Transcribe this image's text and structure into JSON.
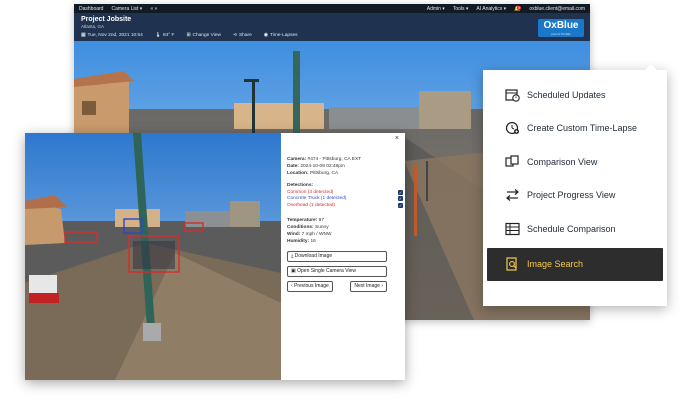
{
  "topnav": {
    "dashboard": "Dashboard",
    "camera_list": "Camera List ▾",
    "nav_arrows": "« »",
    "admin": "Admin ▾",
    "tools": "Tools ▾",
    "ai_analytics": "AI Analytics ▾",
    "notif_count": "9",
    "user_email": "oxblue.client@email.com"
  },
  "header": {
    "title": "Project Jobsite",
    "location": "Atlanta, GA",
    "date": "Tue, Nov 2nd, 2021 10:54",
    "weather": "84° F",
    "change_view": "Change View",
    "share": "Share",
    "timelapses": "Time-Lapses"
  },
  "logo": {
    "text": "OxBlue",
    "sub": "part of Trimble"
  },
  "panel": {
    "close": "×",
    "camera_label": "Camera:",
    "camera_value": "#474 - Pittsburg, CA EXT",
    "date_label": "Date:",
    "date_value": "2024-10-08 02:48pm",
    "location_label": "Location:",
    "location_value": "Pittsburg, CA",
    "detections_label": "Detections:",
    "detections": [
      {
        "label": "Common (3 detected)",
        "color": "#d62c2c"
      },
      {
        "label": "Concrete Truck (1 detected)",
        "color": "#2b47c9"
      },
      {
        "label": "Overhead (1 detected)",
        "color": "#d62c2c"
      }
    ],
    "temperature_label": "Temperature:",
    "temperature_value": "97",
    "conditions_label": "Conditions:",
    "conditions_value": "Sunny",
    "wind_label": "Wind:",
    "wind_value": "7 mph / WNW",
    "humidity_label": "Humidity:",
    "humidity_value": "16",
    "download": "Download Image",
    "open_single": "Open Single Camera View",
    "previous": "Previous Image",
    "next": "Next Image"
  },
  "menu": {
    "items": [
      {
        "label": "Scheduled Updates",
        "icon": "calendar-clock-icon"
      },
      {
        "label": "Create Custom Time-Lapse",
        "icon": "clock-plus-icon"
      },
      {
        "label": "Comparison View",
        "icon": "compare-icon"
      },
      {
        "label": "Project Progress View",
        "icon": "progress-arrows-icon"
      },
      {
        "label": "Schedule Comparison",
        "icon": "gantt-icon"
      },
      {
        "label": "Image Search",
        "icon": "image-search-icon"
      }
    ],
    "active_index": 5
  }
}
